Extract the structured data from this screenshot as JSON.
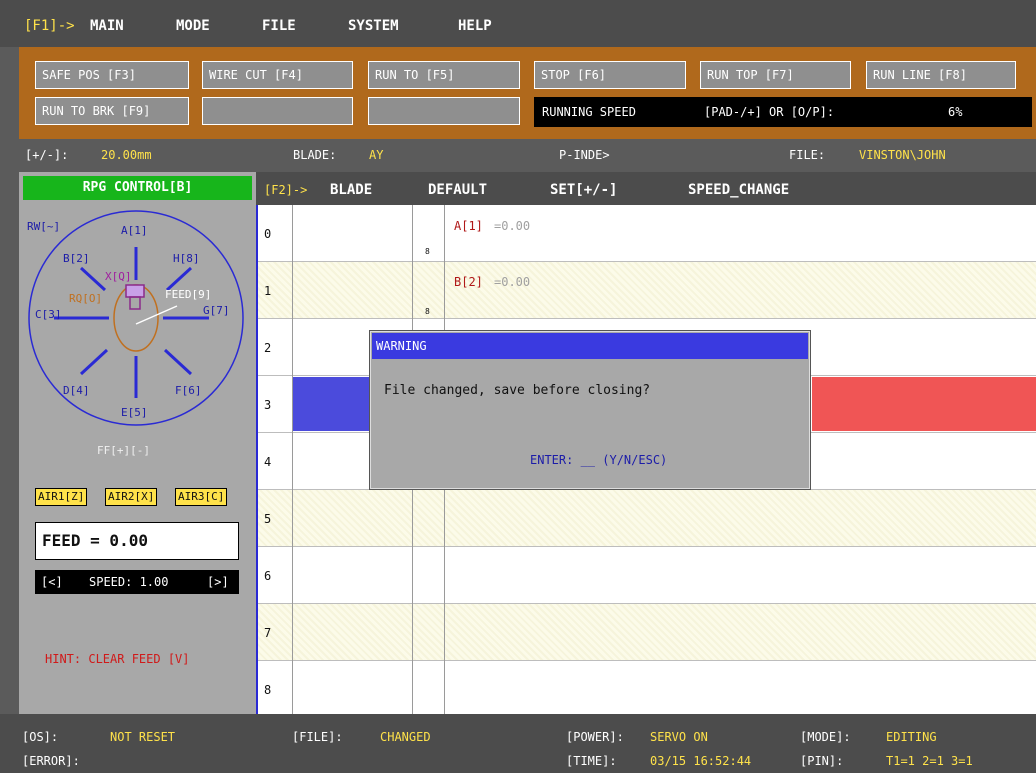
{
  "menu": {
    "prefix": "[F1]->",
    "items": [
      "MAIN",
      "MODE",
      "FILE",
      "SYSTEM",
      "HELP"
    ]
  },
  "commands": {
    "row1": [
      "SAFE POS [F3]",
      "WIRE CUT [F4]",
      "RUN TO [F5]",
      "STOP [F6]",
      "RUN TOP [F7]",
      "RUN LINE [F8]"
    ],
    "row2": [
      "RUN TO BRK [F9]",
      "",
      ""
    ],
    "speed_label": "RUNNING SPEED",
    "speed_hint": "[PAD-/+] OR [O/P]:",
    "speed_value": "6%"
  },
  "status": {
    "step_label": "[+/-]:",
    "step_value": "20.00mm",
    "blade_label": "BLADE:",
    "blade_value": "AY",
    "pindex": "P-INDE>",
    "file_label": "FILE:",
    "file_value": "VINSTON\\JOHN"
  },
  "rpg": {
    "header": "RPG CONTROL[B]",
    "labels": {
      "rw": "RW[~]",
      "a": "A[1]",
      "b": "B[2]",
      "h": "H[8]",
      "x": "X[Q]",
      "rq": "RQ[O]",
      "feed": "FEED[9]",
      "c": "C[3]",
      "g": "G[7]",
      "d": "D[4]",
      "f": "F[6]",
      "e": "E[5]"
    },
    "ff": "FF[+][-]",
    "air": [
      "AIR1[Z]",
      "AIR2[X]",
      "AIR3[C]"
    ],
    "feed_display": "FEED = 0.00",
    "speed_left": "[<]",
    "speed_text": "SPEED: 1.00",
    "speed_right": "[>]",
    "hint": "HINT: CLEAR FEED [V]"
  },
  "tabs": {
    "prefix": "[F2]->",
    "items": [
      "BLADE",
      "DEFAULT",
      "SET[+/-]",
      "SPEED_CHANGE"
    ]
  },
  "grid": {
    "rows": [
      "0",
      "1",
      "2",
      "3",
      "4",
      "5",
      "6",
      "7",
      "8"
    ],
    "cells": [
      {
        "name": "A[1]",
        "value": "=0.00"
      },
      {
        "name": "B[2]",
        "value": "=0.00"
      }
    ],
    "marker": "8"
  },
  "dialog": {
    "title": "WARNING",
    "message": "File changed, save before closing?",
    "prompt": "ENTER: __ (Y/N/ESC)"
  },
  "footer": {
    "os_label": "[OS]:",
    "os_value": "NOT RESET",
    "file_label": "[FILE]:",
    "file_value": "CHANGED",
    "power_label": "[POWER]:",
    "power_value": "SERVO ON",
    "mode_label": "[MODE]:",
    "mode_value": "EDITING",
    "error_label": "[ERROR]:",
    "time_label": "[TIME]:",
    "time_value": "03/15 16:52:44",
    "pin_label": "[PIN]:",
    "pin_value": "T1=1 2=1 3=1"
  },
  "colors": {
    "accent_yellow": "#ffe24a",
    "panel_orange": "#b0691c",
    "rpg_green": "#17b51b",
    "dialog_blue": "#3a3ae0",
    "row_blue": "#4b4bdc",
    "row_red": "#f05555"
  }
}
